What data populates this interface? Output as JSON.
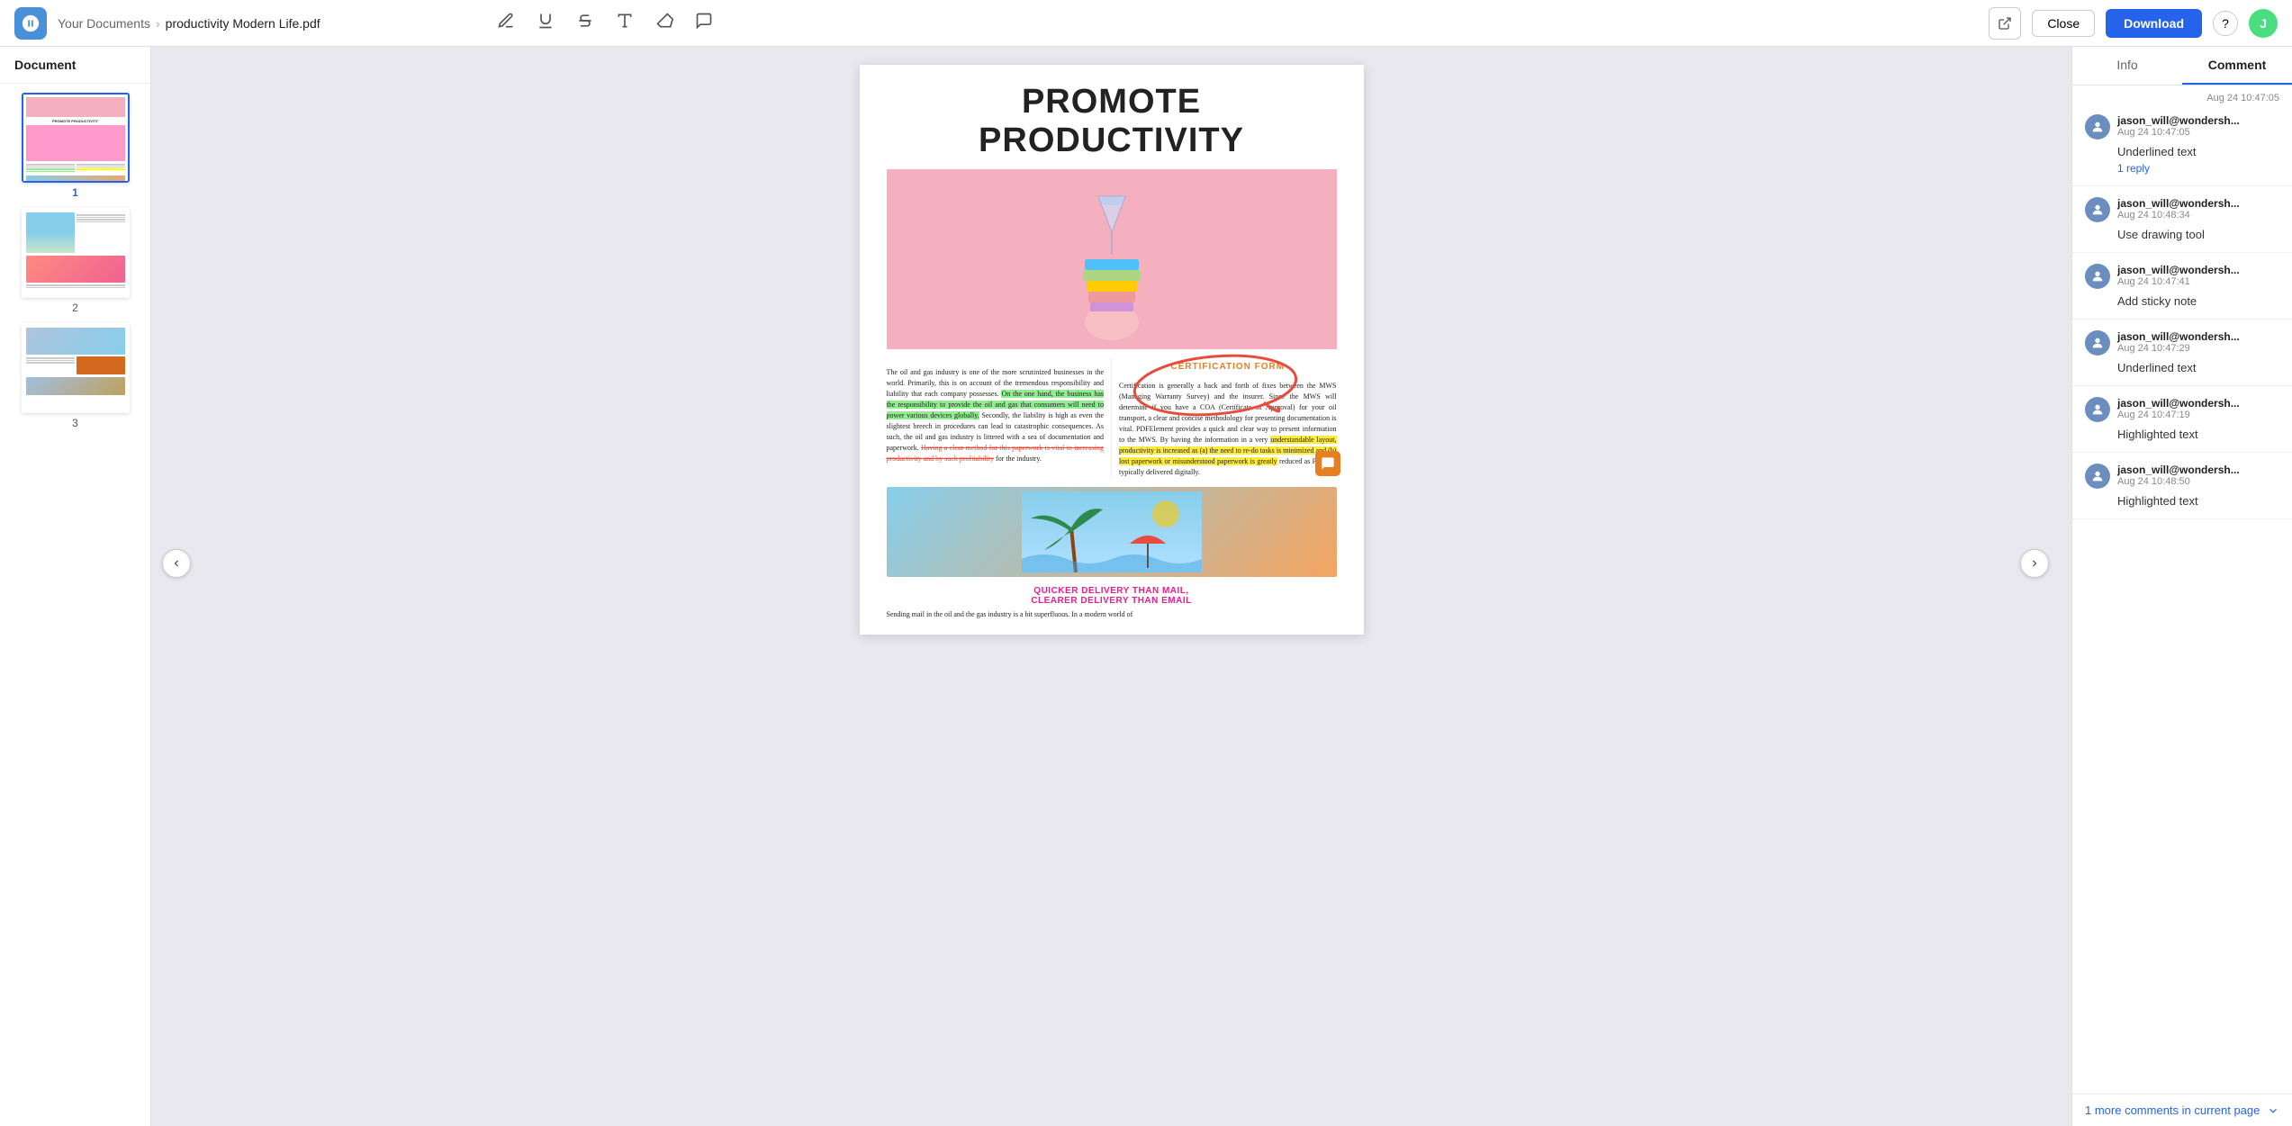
{
  "header": {
    "breadcrumb_parent": "Your Documents",
    "breadcrumb_current": "productivity Modern Life.pdf",
    "close_label": "Close",
    "download_label": "Download",
    "help_label": "?",
    "avatar_initials": "J"
  },
  "sidebar": {
    "title": "Document",
    "pages": [
      {
        "num": "1",
        "active": true
      },
      {
        "num": "2",
        "active": false
      },
      {
        "num": "3",
        "active": false
      }
    ]
  },
  "pdf": {
    "title": "PROMOTE PRODUCTIVITY",
    "left_text": "The oil and gas industry is one of the more scrutinized businesses in the world. Primarily, this is on account of the tremendous responsibility and liability that each company possesses.",
    "left_highlighted": "On the one hand, the business has the responsibility to provide the oil and gas that consumers will need to power various devices globally.",
    "left_text2": "Secondly, the liability is high as even the slightest breech in procedures can lead to catastrophic consequences. As such, the oil and gas industry is littered with a sea of documentation and paperwork.",
    "left_strikethrough": "Having a clear method for this paperwork is vital to increasing productivity and by such profitability",
    "left_text3": "for the industry.",
    "cert_label": "CERTIFICATION FORM",
    "right_text1": "Certification is generally a back and forth of fixes between the MWS (Managing Warranty Survey) and the insurer. Since the MWS will determine if you have a COA (Certificate of Approval) for your oil transport, a clear and concise methodology for presenting documentation is vital. PDFElement provides a quick and clear way to present information to the MWS. By having the information in a very",
    "right_highlighted_yellow": "understandable layout, productivity is increased as (a) the need to re-do tasks is minimized and (b) lost paperwork or misunderstood paperwork is greatly",
    "right_text2": "reduced as PDFs as typically delivered digitally.",
    "pink_heading_line1": "QUICKER DELIVERY THAN MAIL,",
    "pink_heading_line2": "CLEARER DELIVERY THAN EMAIL",
    "bottom_text": "Sending mail in the oil and the gas industry is a bit superfluous. In a modern world of"
  },
  "right_panel": {
    "tabs": [
      "Info",
      "Comment"
    ],
    "active_tab": "Comment",
    "top_date": "Aug 24 10:47:05",
    "comments": [
      {
        "username": "jason_will@wondersh...",
        "date": "Aug 24 10:47:05",
        "text": "Underlined text",
        "replies": "1 reply"
      },
      {
        "username": "jason_will@wondersh...",
        "date": "Aug 24 10:48:34",
        "text": "Use drawing tool",
        "replies": null
      },
      {
        "username": "jason_will@wondersh...",
        "date": "Aug 24 10:47:41",
        "text": "Add sticky note",
        "replies": null
      },
      {
        "username": "jason_will@wondersh...",
        "date": "Aug 24 10:47:29",
        "text": "Underlined text",
        "replies": null
      },
      {
        "username": "jason_will@wondersh...",
        "date": "Aug 24 10:47:19",
        "text": "Highlighted text",
        "replies": null
      },
      {
        "username": "jason_will@wondersh...",
        "date": "Aug 24 10:48:50",
        "text": "Highlighted text",
        "replies": null
      }
    ],
    "more_comments_label": "1 more comments in current page"
  }
}
